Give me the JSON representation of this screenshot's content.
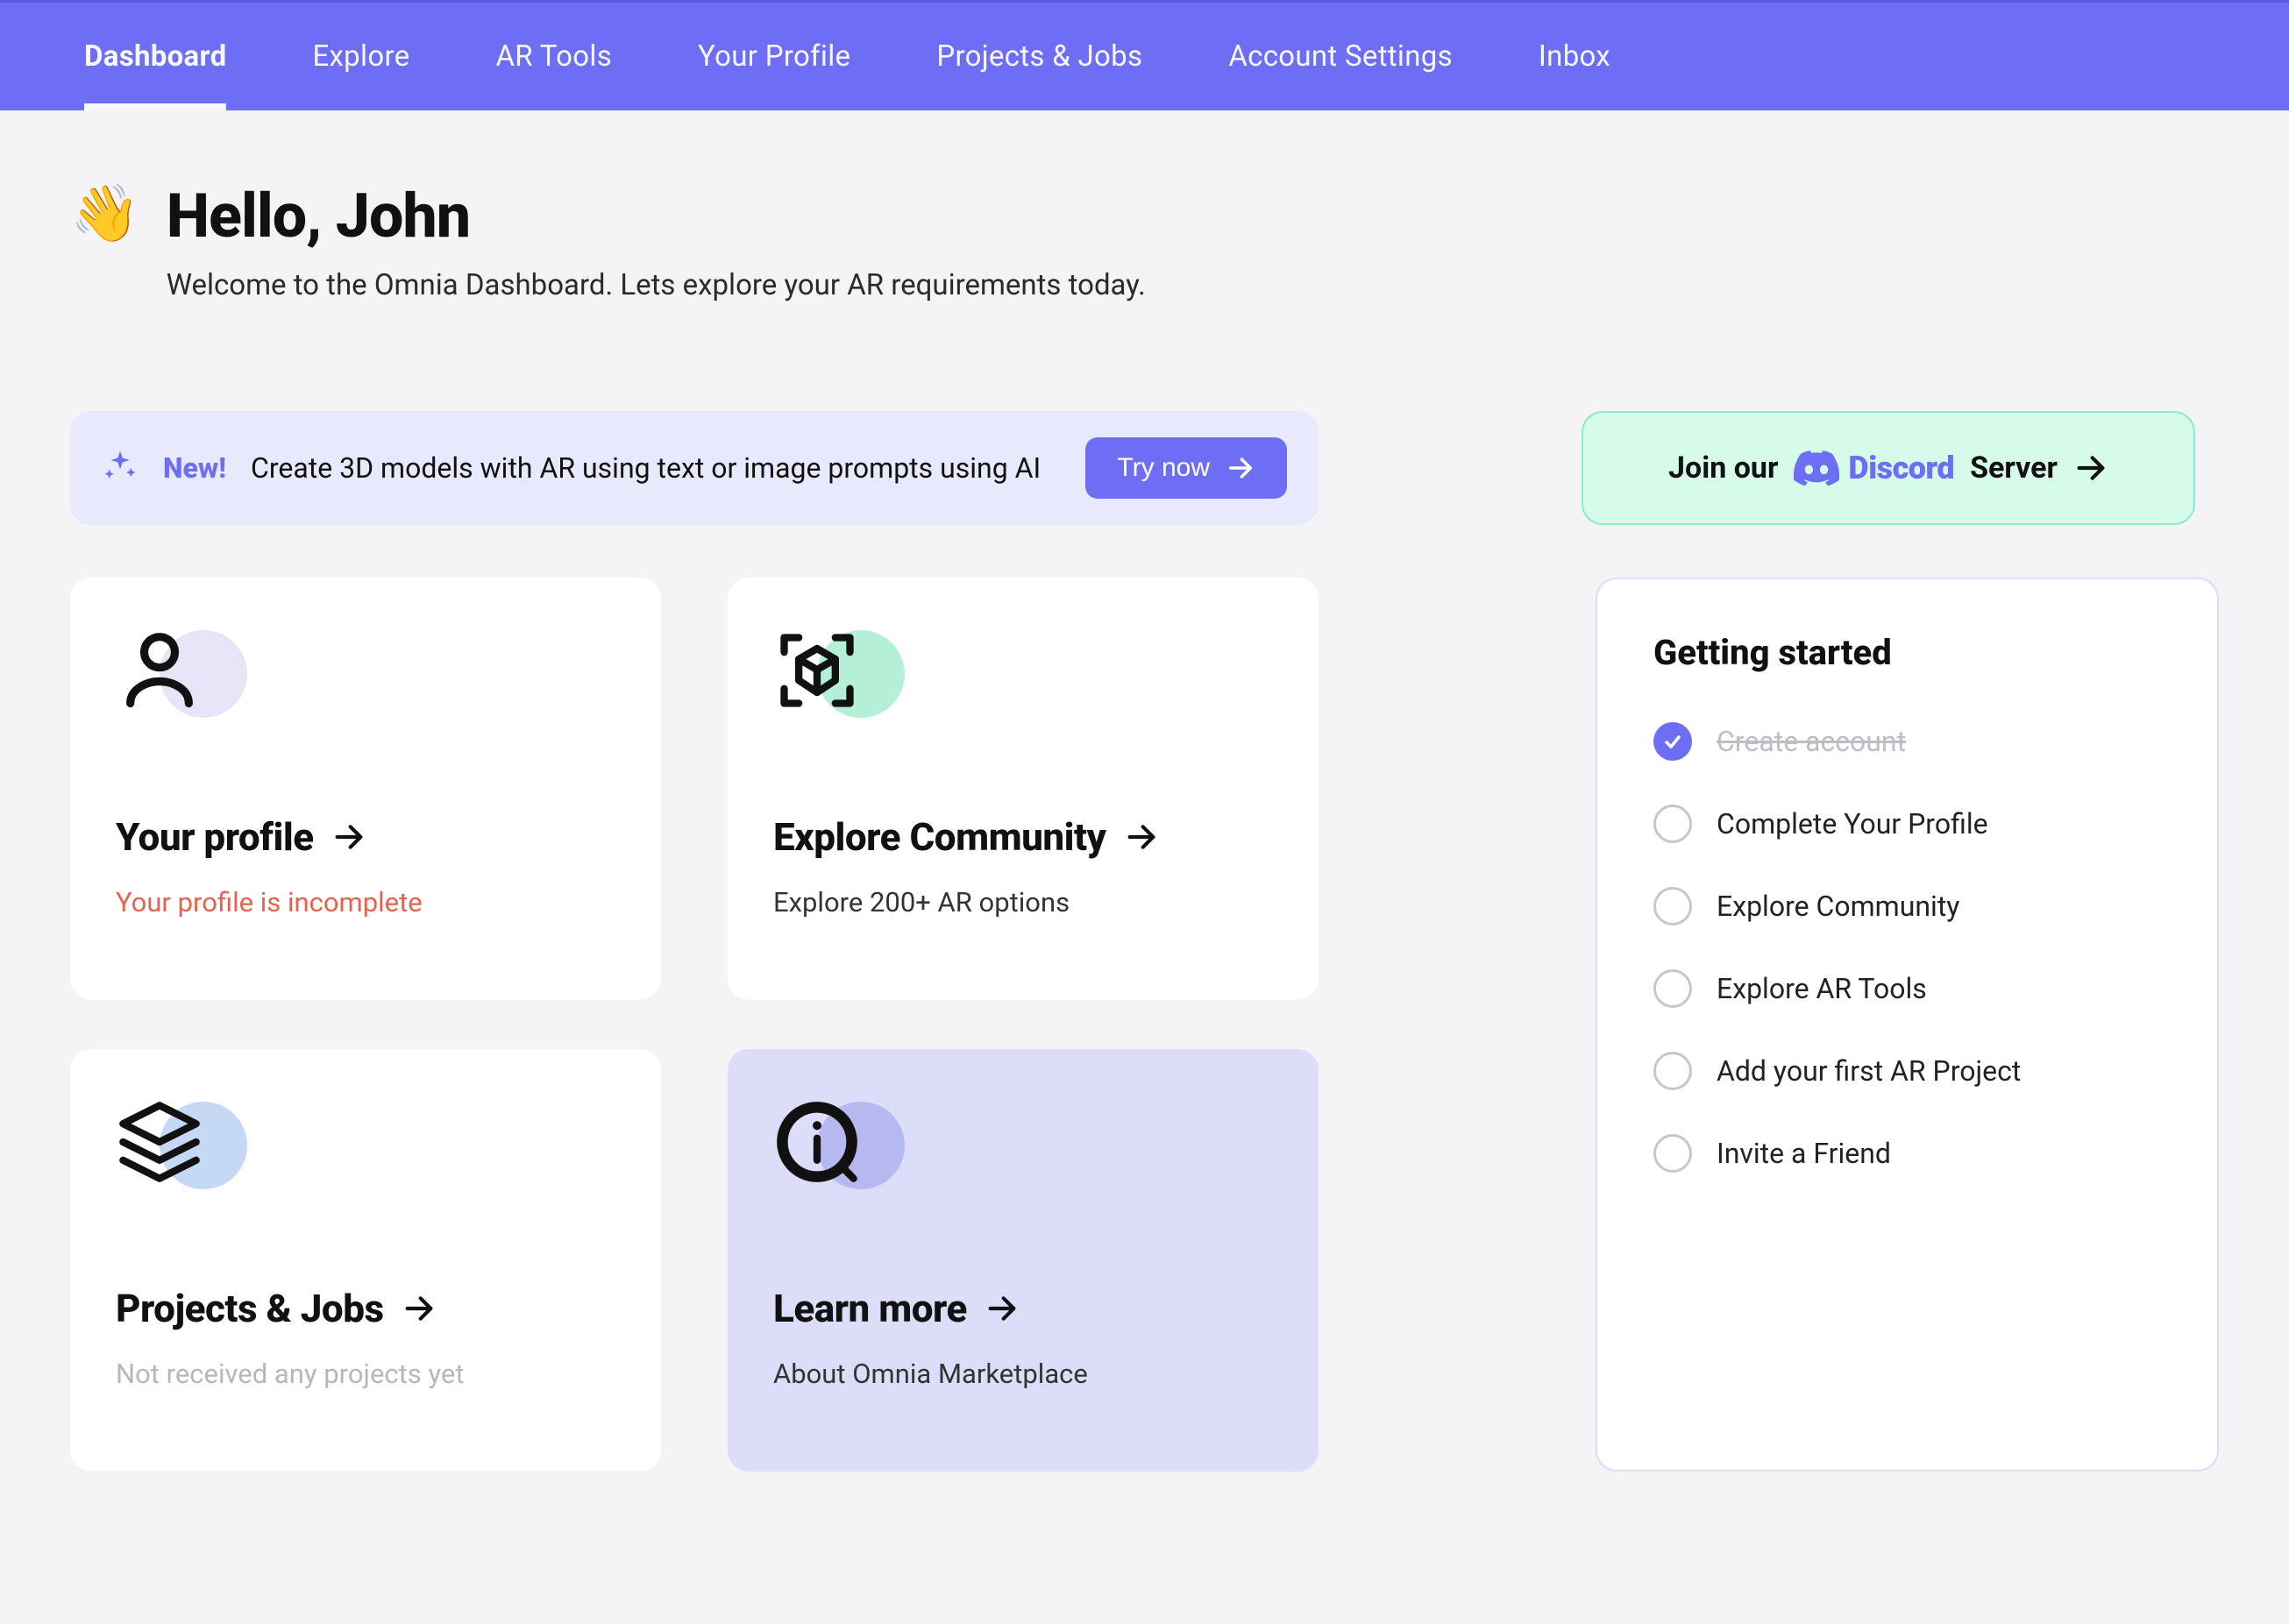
{
  "nav": {
    "items": [
      {
        "label": "Dashboard",
        "active": true
      },
      {
        "label": "Explore",
        "active": false
      },
      {
        "label": "AR Tools",
        "active": false
      },
      {
        "label": "Your Profile",
        "active": false
      },
      {
        "label": "Projects & Jobs",
        "active": false
      },
      {
        "label": "Account Settings",
        "active": false
      },
      {
        "label": "Inbox",
        "active": false
      }
    ]
  },
  "greeting": {
    "emoji": "👋",
    "title": "Hello, John",
    "subtitle": "Welcome to the Omnia Dashboard. Lets explore your AR requirements today."
  },
  "promo": {
    "tag": "New!",
    "text": "Create 3D models with AR using text or image prompts using AI",
    "cta": "Try now"
  },
  "discord": {
    "prefix": "Join our",
    "brand": "Discord",
    "suffix": "Server"
  },
  "cards": {
    "profile": {
      "title": "Your profile",
      "subtitle": "Your profile is incomplete"
    },
    "community": {
      "title": "Explore Community",
      "subtitle": "Explore 200+ AR options"
    },
    "projects": {
      "title": "Projects & Jobs",
      "subtitle": "Not received any projects yet"
    },
    "learn": {
      "title": "Learn more",
      "subtitle": "About Omnia Marketplace"
    }
  },
  "getting_started": {
    "title": "Getting started",
    "items": [
      {
        "label": "Create account",
        "done": true
      },
      {
        "label": "Complete Your Profile",
        "done": false
      },
      {
        "label": "Explore Community",
        "done": false
      },
      {
        "label": "Explore AR Tools",
        "done": false
      },
      {
        "label": "Add your first AR Project",
        "done": false
      },
      {
        "label": "Invite a Friend",
        "done": false
      }
    ]
  }
}
